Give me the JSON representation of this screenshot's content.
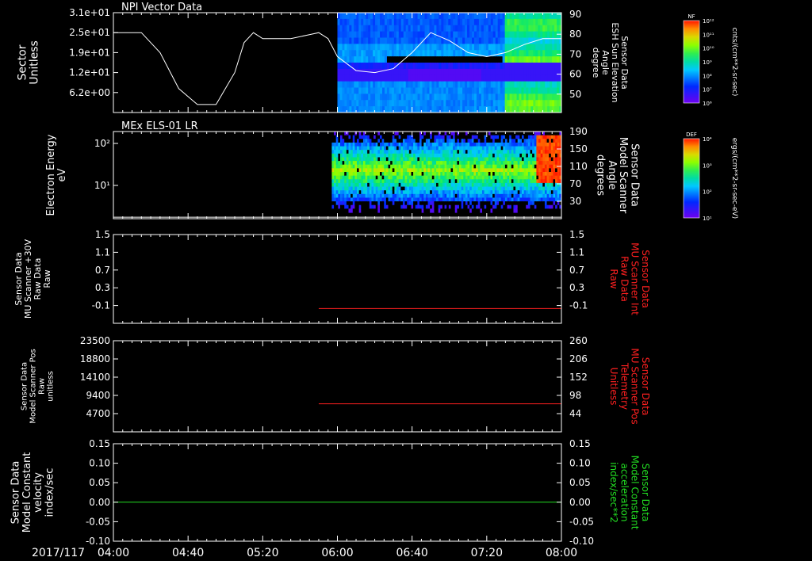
{
  "date_label": "2017/117",
  "x_ticks": [
    "04:00",
    "04:40",
    "05:20",
    "06:00",
    "06:40",
    "07:20",
    "08:00"
  ],
  "panels": [
    {
      "title": "NPI Vector Data",
      "left_label": [
        "Sector",
        "Unitless"
      ],
      "left_ticks": [
        "3.1e+01",
        "2.5e+01",
        "1.9e+01",
        "1.2e+01",
        "6.2e+00"
      ],
      "right_label": [
        "Sensor Data",
        "ESH Sun Elevation",
        "Angle",
        "degree"
      ],
      "right_ticks": [
        "90",
        "80",
        "70",
        "60",
        "50"
      ],
      "right_color": "#ffffff"
    },
    {
      "title": "MEx ELS-01 LR",
      "left_label": [
        "Electron Energy",
        "eV"
      ],
      "left_ticks": [
        "10²",
        "10¹"
      ],
      "right_label": [
        "Sensor Data",
        "Model Scanner",
        "Angle",
        "degrees"
      ],
      "right_ticks": [
        "190",
        "150",
        "110",
        "70",
        "30"
      ],
      "right_color": "#ffffff"
    },
    {
      "title": "",
      "left_label": [
        "Sensor Data",
        "MU Scanner +30V",
        "Raw Data",
        "Raw"
      ],
      "left_ticks": [
        "1.5",
        "1.1",
        "0.7",
        "0.3",
        "-0.1"
      ],
      "right_label": [
        "Sensor Data",
        "MU Scanner Int",
        "Raw Data",
        "Raw"
      ],
      "right_ticks": [
        "1.5",
        "1.1",
        "0.7",
        "0.3",
        "-0.1"
      ],
      "right_color": "#ff2020"
    },
    {
      "title": "",
      "left_label": [
        "Sensor Data",
        "Model Scanner Pos",
        "Raw",
        "unitless"
      ],
      "left_ticks": [
        "23500",
        "18800",
        "14100",
        "9400",
        "4700"
      ],
      "right_label": [
        "Sensor Data",
        "MU Scanner Pos",
        "Telemetry",
        "Unitless"
      ],
      "right_ticks": [
        "260",
        "206",
        "152",
        "98",
        "44"
      ],
      "right_color": "#ff2020"
    },
    {
      "title": "",
      "left_label": [
        "Sensor Data",
        "Model Constant",
        "velocity",
        "index/sec"
      ],
      "left_ticks": [
        "0.15",
        "0.10",
        "0.05",
        "0.00",
        "-0.05",
        "-0.10"
      ],
      "right_label": [
        "Sensor Data",
        "Model Constant",
        "acceleration",
        "index/sec**2"
      ],
      "right_ticks": [
        "0.15",
        "0.10",
        "0.05",
        "0.00",
        "-0.05",
        "-0.10"
      ],
      "right_color": "#22dd22"
    }
  ],
  "colorbars": [
    {
      "tag": "NF",
      "label": "cnts/(cm**2-sr-sec)",
      "ticks": [
        "10¹²",
        "10¹¹",
        "10¹⁰",
        "10⁹",
        "10⁸",
        "10⁷",
        "10⁶"
      ]
    },
    {
      "tag": "DEF",
      "label": "ergs/(cm**2-sr-sec-eV)",
      "ticks": [
        "10⁴",
        "10³",
        "10²",
        "10¹"
      ]
    }
  ],
  "colors": {
    "line_white": "#ffffff",
    "line_red": "#ff2020",
    "line_green": "#22dd22",
    "background": "#000000"
  },
  "chart_data": [
    {
      "type": "heatmap",
      "title": "NPI Vector Data",
      "ylabel": "Sector Unitless",
      "y2label": "Sensor Data ESH Sun Elevation Angle degree",
      "x_range": [
        "04:00",
        "08:00"
      ],
      "y2lim": [
        40,
        90
      ],
      "data_start": "06:00",
      "overlay_line": {
        "name": "ESH Sun Elevation",
        "x": [
          "04:00",
          "04:15",
          "04:25",
          "04:35",
          "04:45",
          "04:55",
          "05:05",
          "05:10",
          "05:15",
          "05:20",
          "05:25",
          "05:35",
          "05:45",
          "05:50",
          "05:55",
          "06:00",
          "06:10",
          "06:20",
          "06:30",
          "06:40",
          "06:50",
          "07:00",
          "07:10",
          "07:20",
          "07:30",
          "07:40",
          "07:50",
          "08:00"
        ],
        "y": [
          80,
          80,
          70,
          52,
          44,
          44,
          60,
          75,
          80,
          77,
          77,
          77,
          79,
          80,
          77,
          68,
          61,
          60,
          62,
          70,
          80,
          76,
          70,
          68,
          70,
          74,
          77,
          77
        ]
      }
    },
    {
      "type": "heatmap",
      "title": "MEx ELS-01 LR",
      "ylabel": "Electron Energy eV",
      "y2label": "Sensor Data Model Scanner Angle degrees",
      "x_range": [
        "04:00",
        "08:00"
      ],
      "y2lim": [
        10,
        190
      ],
      "data_start": "05:57",
      "overlay_line": {
        "name": "Model Scanner Angle",
        "x": [
          "04:00",
          "08:00"
        ],
        "y": [
          13,
          13
        ]
      }
    },
    {
      "type": "line",
      "ylabel": "Sensor Data MU Scanner +30V Raw Data Raw",
      "y2label": "Sensor Data MU Scanner Int Raw Data Raw",
      "ylim": [
        -0.3,
        1.5
      ],
      "series": [
        {
          "x": [
            "05:50",
            "08:00"
          ],
          "y": [
            0,
            0
          ]
        }
      ]
    },
    {
      "type": "line",
      "ylabel": "Sensor Data Model Scanner Pos Raw unitless",
      "y2label": "Sensor Data MU Scanner Pos Telemetry Unitless",
      "ylim": [
        0,
        23500
      ],
      "y2lim": [
        0,
        260
      ],
      "series": [
        {
          "x": [
            "05:50",
            "08:00"
          ],
          "y": [
            80,
            80
          ],
          "axis": "right"
        }
      ]
    },
    {
      "type": "line",
      "ylabel": "Sensor Data Model Constant velocity index/sec",
      "y2label": "Sensor Data Model Constant acceleration index/sec**2",
      "ylim": [
        -0.1,
        0.15
      ],
      "series": [
        {
          "x": [
            "04:00",
            "08:00"
          ],
          "y": [
            0,
            0
          ]
        }
      ]
    }
  ]
}
